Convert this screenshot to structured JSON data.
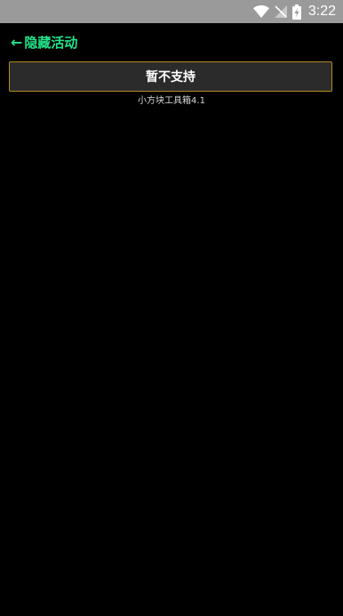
{
  "status_bar": {
    "time": "3:22",
    "icons": [
      "wifi-icon",
      "signal-off-icon",
      "battery-charging-icon"
    ]
  },
  "app_bar": {
    "back_arrow": "←",
    "title": "隐藏活动"
  },
  "main": {
    "button_label": "暂不支持",
    "version_text": "小方块工具箱4.1"
  },
  "colors": {
    "background": "#000000",
    "status_bar": "#9a9a9a",
    "title_green": "#22e38a",
    "button_bg": "#2b2b2b",
    "button_border": "#b38a1e"
  }
}
